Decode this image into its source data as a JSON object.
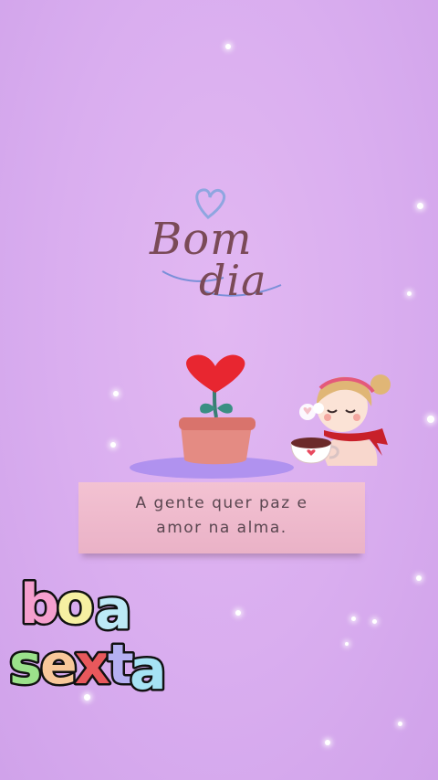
{
  "greeting": {
    "line1": "Bom",
    "line2": "dia"
  },
  "banner": {
    "text": "A gente quer  paz e\namor na alma."
  },
  "sticker": {
    "line1": "boa",
    "line2": "sexta"
  },
  "colors": {
    "background": "#d9adef",
    "heart": "#e82630",
    "pot": "#e48b83",
    "banner": "#eeb8cb",
    "greeting_text": "#7a4a57"
  },
  "icons": [
    "heart-icon",
    "plant-pot-icon",
    "girl-with-coffee-icon",
    "sparkle-icon"
  ]
}
